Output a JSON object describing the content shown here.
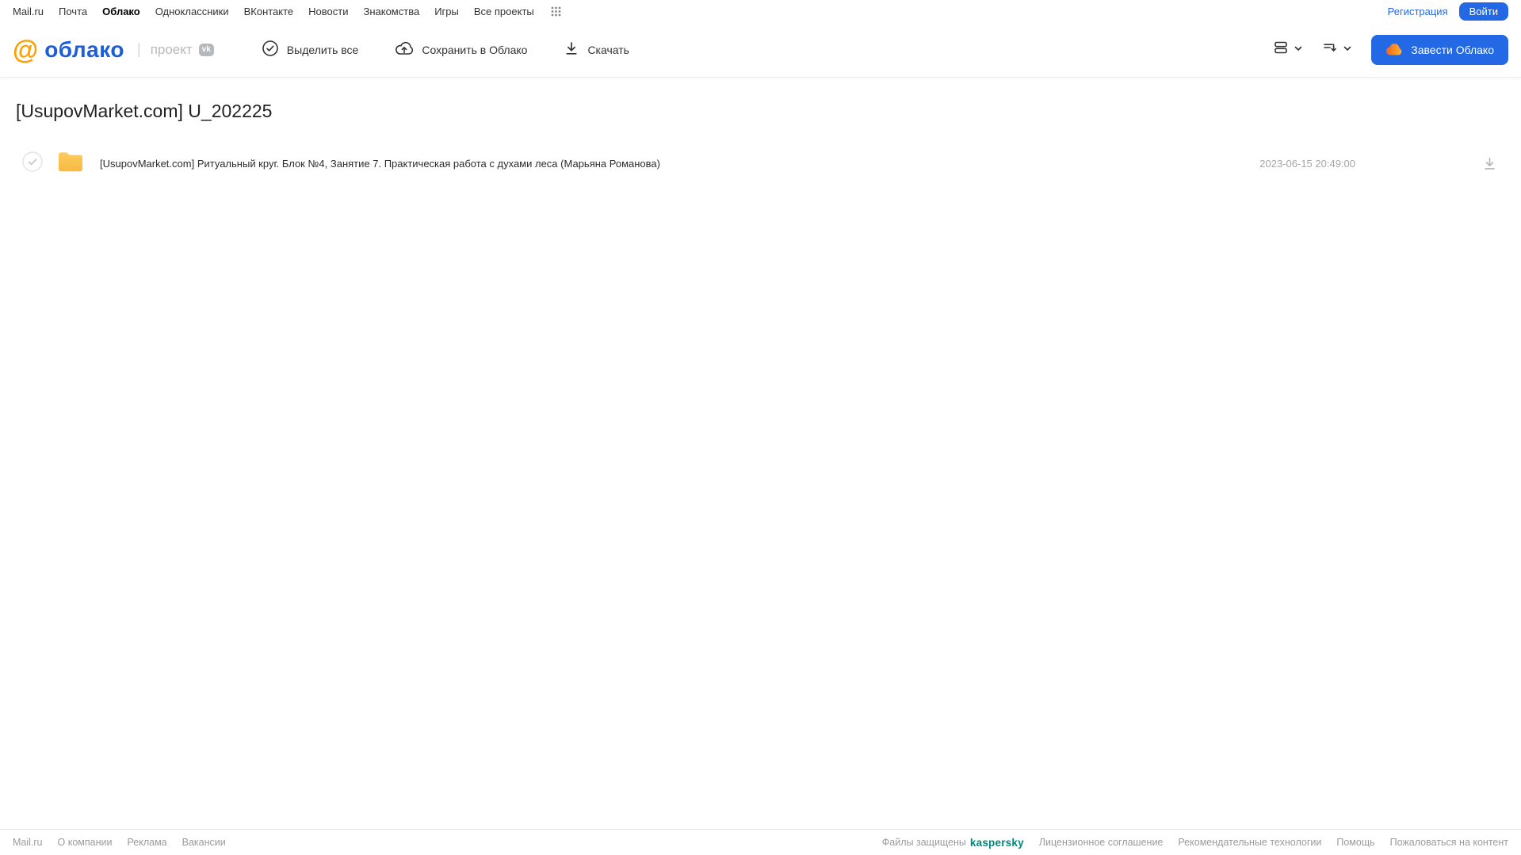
{
  "top_nav": {
    "items": [
      "Mail.ru",
      "Почта",
      "Облако",
      "Одноклассники",
      "ВКонтакте",
      "Новости",
      "Знакомства",
      "Игры",
      "Все проекты"
    ],
    "registration_label": "Регистрация",
    "login_label": "Войти"
  },
  "header": {
    "logo_at": "@",
    "logo_text": "облако",
    "project_label": "проект",
    "vk_badge": "vk",
    "toolbar": {
      "select_all_label": "Выделить все",
      "save_label": "Сохранить в Облако",
      "download_label": "Скачать"
    },
    "cta_label": "Завести Облако"
  },
  "main": {
    "title": "[UsupovMarket.com] U_202225",
    "files": [
      {
        "name": "[UsupovMarket.com] Ритуальный круг. Блок №4, Занятие 7. Практическая работа с духами леса (Марьяна Романова)",
        "date": "2023-06-15 20:49:00"
      }
    ]
  },
  "footer": {
    "left_links": [
      "Mail.ru",
      "О компании",
      "Реклама",
      "Вакансии"
    ],
    "protected_label": "Файлы защищены",
    "kaspersky_label": "kaspersky",
    "right_links": [
      "Лицензионное соглашение",
      "Рекомендательные технологии",
      "Помощь",
      "Пожаловаться на контент"
    ]
  },
  "colors": {
    "accent_blue": "#2368e4",
    "logo_blue": "#1b5ed8",
    "logo_orange": "#ff9e00",
    "folder_amber": "#f9bf4e",
    "kaspersky_teal": "#00877b"
  }
}
